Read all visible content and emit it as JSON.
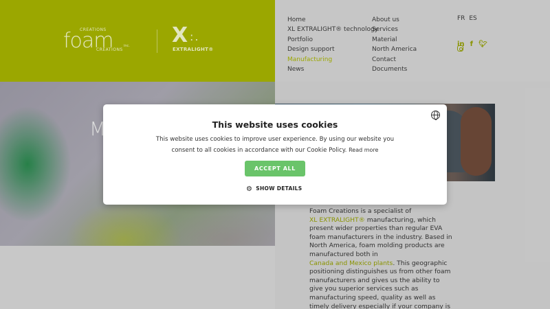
{
  "header": {
    "logo_foam": {
      "top": "CREATIONS",
      "word": "foam",
      "bottom": "CREATIONS",
      "inc": "inc."
    },
    "logo_xl": {
      "mark": "X",
      "dots": ":.",
      "label": "EXTRALIGHT®"
    },
    "nav_col1": [
      "Home",
      "XL EXTRALIGHT® technology",
      "Portfolio",
      "Design support",
      "Manufacturing",
      "News"
    ],
    "nav_col2": [
      "About us",
      "Services",
      "Material",
      "North America",
      "Contact",
      "Documents"
    ],
    "active_item": "Manufacturing",
    "languages": [
      "FR",
      "ES"
    ],
    "social_icons": [
      "linkedin-icon",
      "facebook-icon",
      "twitter-icon",
      "instagram-icon"
    ]
  },
  "hero": {
    "title": "M"
  },
  "content": {
    "p1": "Foam Creations is a specialist of",
    "link1": "XL EXTRALIGHT®",
    "p2": " manufacturing, which present wider properties than regular EVA foam manufacturers in the industry. Based in North America, foam molding products are manufactured both in",
    "link2": "Canada and Mexico plants",
    "p3": ". This geographic positioning distinguishes us from other foam manufacturers and gives us the ability to give you superior services such as manufacturing speed, quality as well as timely delivery especially if your company is based within the"
  },
  "cookie": {
    "title": "This website uses cookies",
    "text": "This website uses cookies to improve user experience. By using our website you consent to all cookies in accordance with our Cookie Policy.",
    "read_more": "Read more",
    "accept": "ACCEPT ALL",
    "details": "SHOW DETAILS"
  },
  "colors": {
    "brand_green": "#a2ae00",
    "accept_green": "#6ac46a"
  }
}
